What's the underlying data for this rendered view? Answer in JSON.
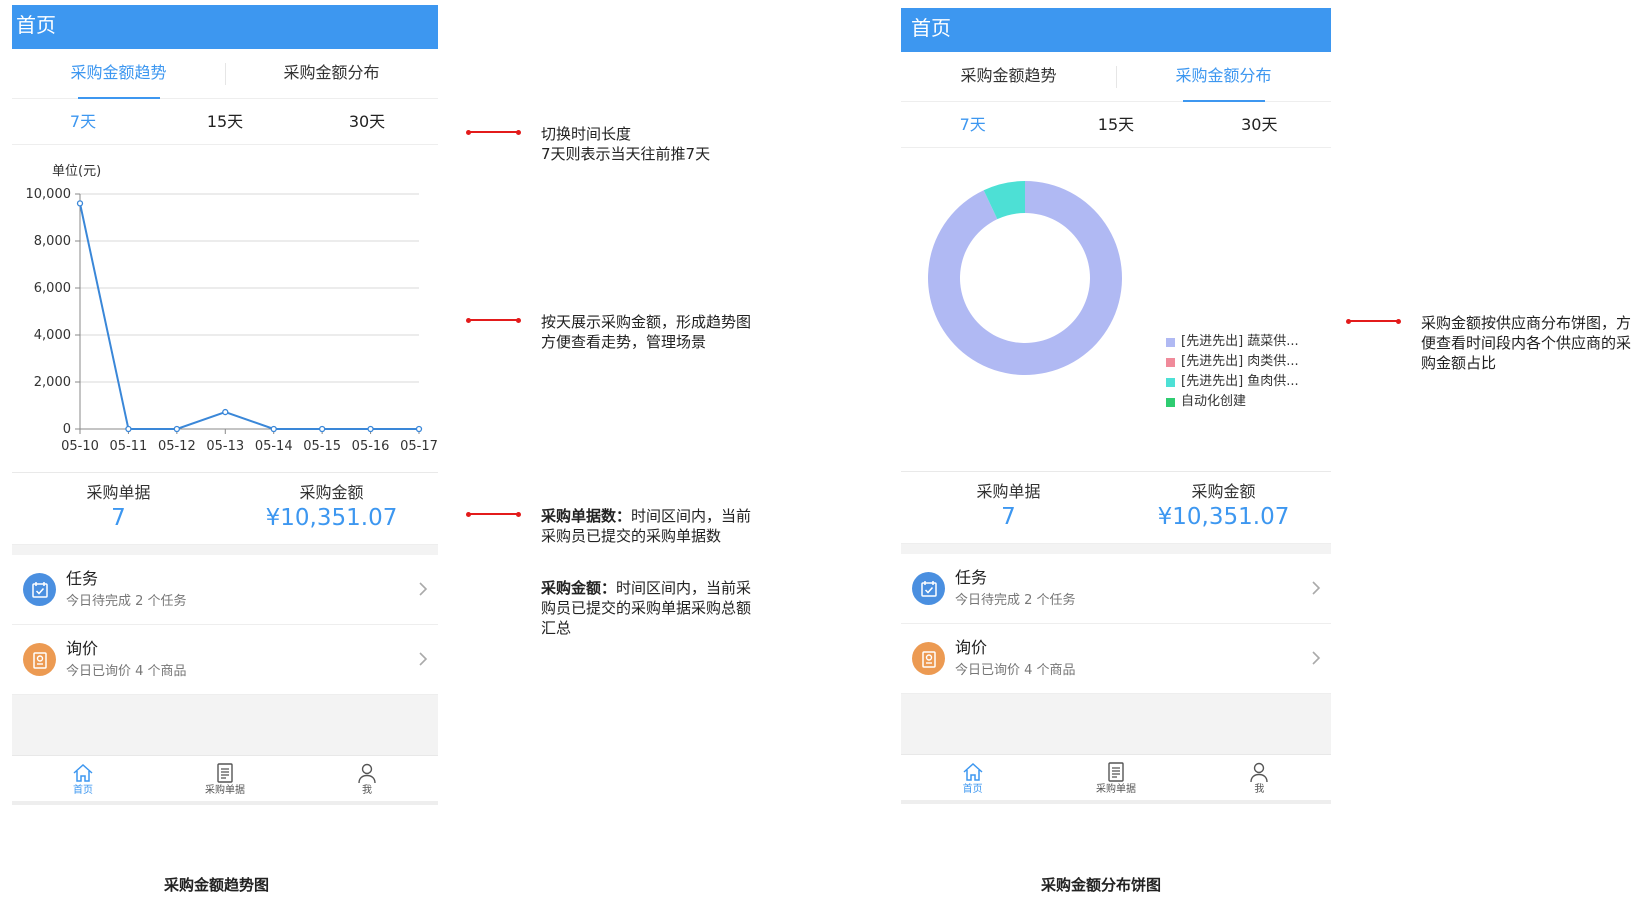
{
  "colors": {
    "primary": "#3d97f0",
    "annotation_red": "#e31b1b",
    "task_icon": "#4a8fe0",
    "inquiry_icon": "#ec9a52"
  },
  "left": {
    "header_title": "首页",
    "tabs": [
      {
        "label": "采购金额趋势",
        "active": true
      },
      {
        "label": "采购金额分布",
        "active": false
      }
    ],
    "ranges": [
      {
        "label": "7天",
        "active": true
      },
      {
        "label": "15天",
        "active": false
      },
      {
        "label": "30天",
        "active": false
      }
    ],
    "stats": {
      "orders_label": "采购单据",
      "orders_value": "7",
      "amount_label": "采购金额",
      "amount_value": "¥10,351.07"
    },
    "list": [
      {
        "title": "任务",
        "sub": "今日待完成 2 个任务",
        "icon": "task-icon"
      },
      {
        "title": "询价",
        "sub": "今日已询价 4 个商品",
        "icon": "inquiry-icon"
      }
    ],
    "nav": [
      {
        "label": "首页",
        "icon": "home-icon",
        "active": true
      },
      {
        "label": "采购单据",
        "icon": "document-icon",
        "active": false
      },
      {
        "label": "我",
        "icon": "user-icon",
        "active": false
      }
    ],
    "caption": "采购金额趋势图"
  },
  "right": {
    "header_title": "首页",
    "tabs": [
      {
        "label": "采购金额趋势",
        "active": false
      },
      {
        "label": "采购金额分布",
        "active": true
      }
    ],
    "ranges": [
      {
        "label": "7天",
        "active": true
      },
      {
        "label": "15天",
        "active": false
      },
      {
        "label": "30天",
        "active": false
      }
    ],
    "stats": {
      "orders_label": "采购单据",
      "orders_value": "7",
      "amount_label": "采购金额",
      "amount_value": "¥10,351.07"
    },
    "list": [
      {
        "title": "任务",
        "sub": "今日待完成 2 个任务",
        "icon": "task-icon"
      },
      {
        "title": "询价",
        "sub": "今日已询价 4 个商品",
        "icon": "inquiry-icon"
      }
    ],
    "nav": [
      {
        "label": "首页",
        "icon": "home-icon",
        "active": true
      },
      {
        "label": "采购单据",
        "icon": "document-icon",
        "active": false
      },
      {
        "label": "我",
        "icon": "user-icon",
        "active": false
      }
    ],
    "caption": "采购金额分布饼图"
  },
  "annotations": {
    "a1_line1": "切换时间长度",
    "a1_line2": "7天则表示当天往前推7天",
    "a2_line1": "按天展示采购金额，形成趋势图",
    "a2_line2": "方便查看走势，管理场景",
    "a3_bold": "采购单据数：",
    "a3_text1": "时间区间内，当前",
    "a3_text2": "采购员已提交的采购单据数",
    "a4_bold": "采购金额：",
    "a4_text1": "时间区间内，当前采",
    "a4_text2": "购员已提交的采购单据采购总额",
    "a4_text3": "汇总",
    "a5_line1": "采购金额按供应商分布饼图，方",
    "a5_line2": "便查看时间段内各个供应商的采",
    "a5_line3": "购金额占比"
  },
  "chart_data": [
    {
      "type": "line",
      "ylabel": "单位(元)",
      "x": [
        "05-10",
        "05-11",
        "05-12",
        "05-13",
        "05-14",
        "05-15",
        "05-16",
        "05-17"
      ],
      "y_ticks": [
        "0",
        "2,000",
        "4,000",
        "6,000",
        "8,000",
        "10,000"
      ],
      "ylim": [
        0,
        10000
      ],
      "grid": true,
      "series": [
        {
          "values": [
            9600,
            0,
            0,
            720,
            0,
            0,
            0,
            0
          ],
          "color": "#3a87d8"
        }
      ]
    },
    {
      "type": "pie",
      "donut": true,
      "legend_position": "bottom-right",
      "slices": [
        {
          "label": "[先进先出] 蔬菜供...",
          "value": 93,
          "color": "#b0b9f3"
        },
        {
          "label": "[先进先出] 肉类供...",
          "value": 0,
          "color": "#f08a9a"
        },
        {
          "label": "[先进先出] 鱼肉供...",
          "value": 7,
          "color": "#4de0d5"
        },
        {
          "label": "自动化创建",
          "value": 0,
          "color": "#2ecc71"
        }
      ]
    }
  ]
}
